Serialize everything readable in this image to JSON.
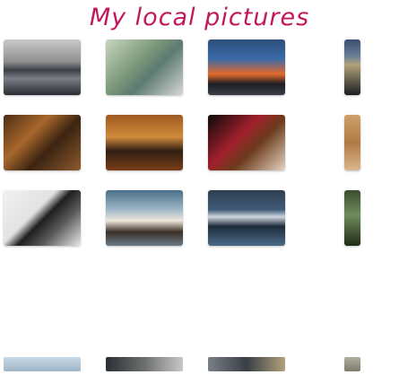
{
  "page": {
    "title": "My local pictures"
  },
  "gallery": {
    "thumbnails": [
      {
        "id": "pic-01",
        "icon": "photo-thumbnail"
      },
      {
        "id": "pic-02",
        "icon": "photo-thumbnail"
      },
      {
        "id": "pic-03",
        "icon": "photo-thumbnail"
      },
      {
        "id": "pic-04",
        "icon": "photo-thumbnail"
      },
      {
        "id": "pic-05",
        "icon": "photo-thumbnail"
      },
      {
        "id": "pic-06",
        "icon": "photo-thumbnail"
      },
      {
        "id": "pic-07",
        "icon": "photo-thumbnail"
      },
      {
        "id": "pic-08",
        "icon": "photo-thumbnail"
      },
      {
        "id": "pic-09",
        "icon": "photo-thumbnail"
      },
      {
        "id": "pic-10",
        "icon": "photo-thumbnail"
      },
      {
        "id": "pic-11",
        "icon": "photo-thumbnail"
      },
      {
        "id": "pic-12",
        "icon": "photo-thumbnail"
      }
    ]
  },
  "colors": {
    "title": "#c2185b",
    "background": "#ffffff"
  }
}
